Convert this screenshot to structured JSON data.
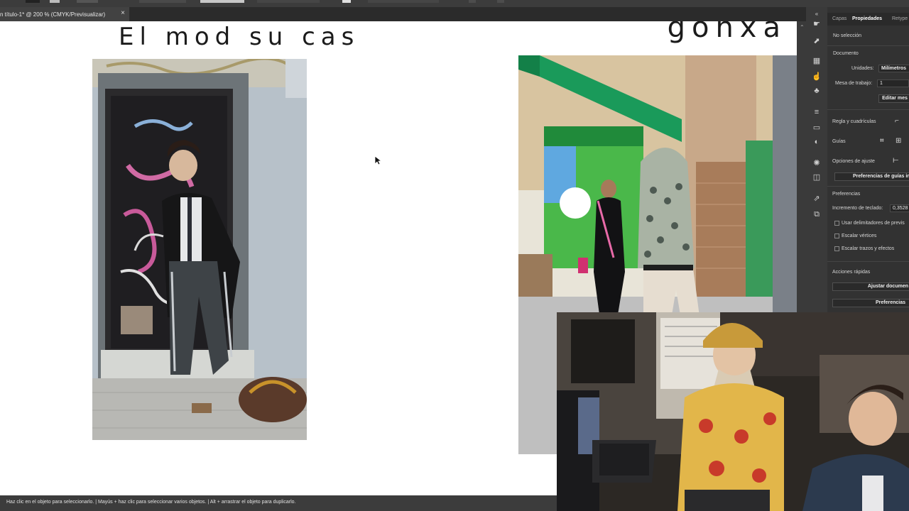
{
  "document": {
    "tab_title": "n título-1* @ 200 % (CMYK/Previsualizar)",
    "close_symbol": "×",
    "canvas_title": "El mod su cas",
    "brand_text": "gonxa"
  },
  "panel": {
    "tabs": [
      "Capas",
      "Propiedades",
      "Retype"
    ],
    "active_tab": "Propiedades",
    "no_selection": "No selección",
    "document_heading": "Documento",
    "units_label": "Unidades:",
    "units_value": "Milímetros",
    "artboard_label": "Mesa de trabajo:",
    "artboard_value": "1",
    "edit_button": "Editar mes",
    "rulers_label": "Regla y cuadrículas",
    "guides_label": "Guías",
    "snap_label": "Opciones de ajuste",
    "guide_prefs_button": "Preferencias de guías int",
    "prefs_heading": "Preferencias",
    "keyboard_inc_label": "Incremento de teclado:",
    "keyboard_inc_value": "0,3528",
    "check_preview_bounds": "Usar delimitadores de previs",
    "check_scale_corners": "Escalar vértices",
    "check_scale_strokes": "Escalar trazos y efectos",
    "quick_actions_heading": "Acciones rápidas",
    "fit_doc_button": "Ajustar documen",
    "prefs_button": "Preferencias"
  },
  "status": {
    "hint": "Haz clic en el objeto para seleccionarlo.  |  Mayús + haz clic para seleccionar varios objetos.  |  Alt + arrastrar el objeto para duplicarlo."
  },
  "icons": {
    "tool_icons": [
      "hand-icon",
      "export-icon",
      "grid-icon",
      "touch-icon",
      "club-icon",
      "menu-icon",
      "gradient-icon",
      "appearance-icon",
      "sun-icon",
      "layers-icon",
      "link-icon",
      "artboards-icon"
    ]
  },
  "colors": {
    "panel_bg": "#323232",
    "canvas_bg": "#ffffff",
    "ui_dark": "#2b2b2b",
    "awning_green": "#1a9a5a"
  }
}
